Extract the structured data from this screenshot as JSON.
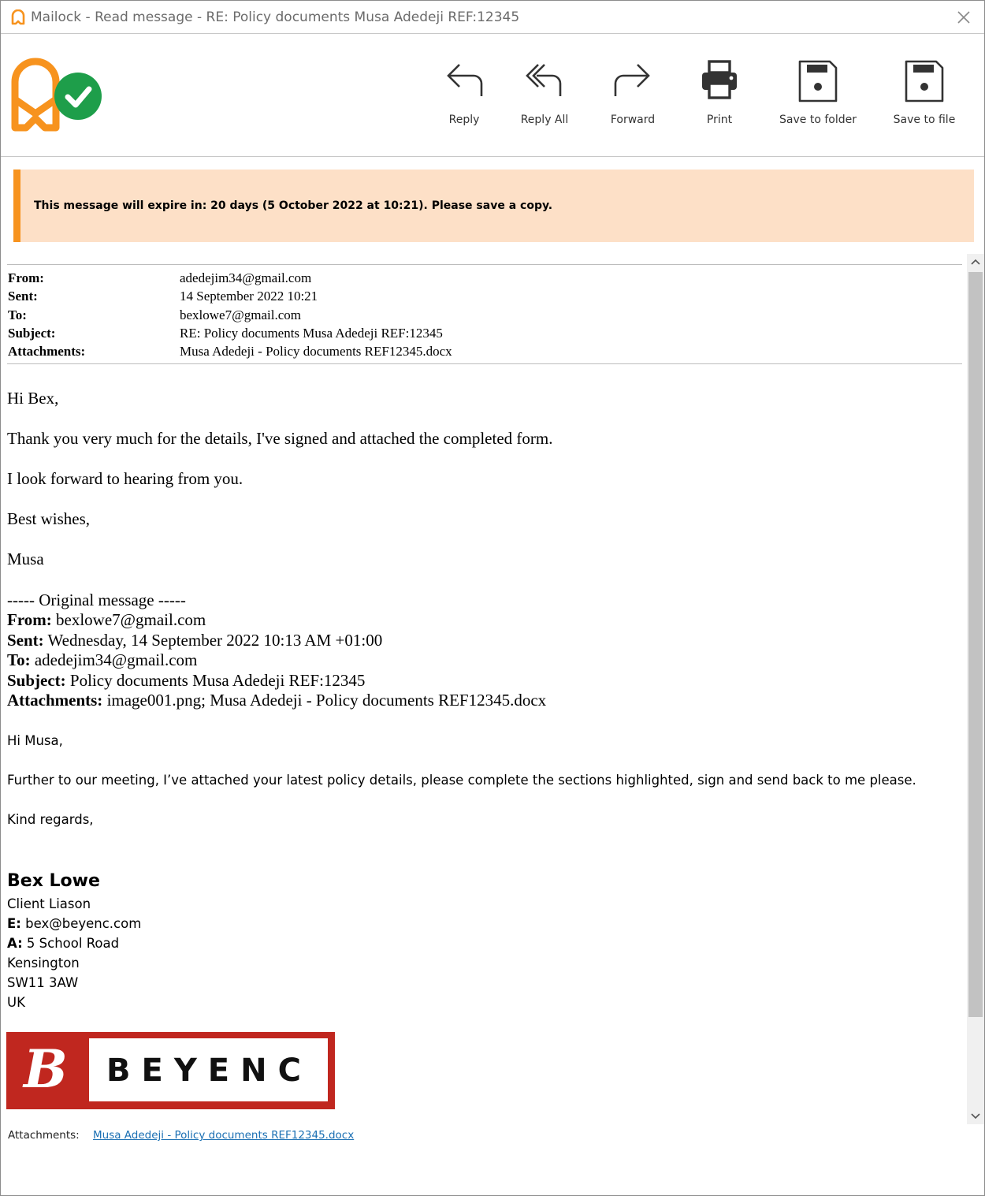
{
  "window": {
    "title": "Mailock - Read message - RE: Policy documents Musa Adedeji REF:12345"
  },
  "toolbar": {
    "reply_label": "Reply",
    "reply_all_label": "Reply All",
    "forward_label": "Forward",
    "print_label": "Print",
    "save_folder_label": "Save to folder",
    "save_file_label": "Save to file"
  },
  "banner": {
    "text": "This message will expire in: 20 days (5 October 2022 at 10:21). Please save a copy."
  },
  "header": {
    "from_label": "From:",
    "from_value": "adedejim34@gmail.com",
    "sent_label": "Sent:",
    "sent_value": "14 September 2022 10:21",
    "to_label": "To:",
    "to_value": "bexlowe7@gmail.com",
    "subject_label": "Subject:",
    "subject_value": "RE: Policy documents Musa Adedeji REF:12345",
    "attachments_label": "Attachments:",
    "attachments_value": "Musa Adedeji - Policy documents REF12345.docx"
  },
  "body": {
    "greeting": "Hi Bex,",
    "line1": "Thank you very much for the details, I've signed and attached the completed form.",
    "line2": "I look forward to hearing from you.",
    "closing": "Best wishes,",
    "signoff": "Musa"
  },
  "original": {
    "divider": "----- Original message -----",
    "from_label": "From:",
    "from_value": " bexlowe7@gmail.com",
    "sent_label": "Sent:",
    "sent_value": " Wednesday, 14 September 2022 10:13 AM +01:00",
    "to_label": "To:",
    "to_value": " adedejim34@gmail.com",
    "subject_label": "Subject:",
    "subject_value": " Policy documents Musa Adedeji REF:12345",
    "attachments_label": "Attachments:",
    "attachments_value": " image001.png; Musa Adedeji - Policy documents REF12345.docx",
    "greeting": "Hi Musa,",
    "line1": "Further to our meeting, I’ve attached your latest policy details, please complete the sections highlighted, sign and send back to me please.",
    "closing": "Kind regards,"
  },
  "signature": {
    "name": "Bex Lowe",
    "role": "Client Liason",
    "email_label": "E:",
    "email_value": " bex@beyenc.com",
    "address_label": "A:",
    "address_value": " 5 School Road",
    "address_line2": "Kensington",
    "address_line3": "SW11 3AW",
    "address_line4": "UK",
    "logo_text": "BEYENC",
    "logo_mark": "B"
  },
  "footer": {
    "attachments_label": "Attachments:",
    "attachment_link": "Musa Adedeji - Policy documents REF12345.docx"
  },
  "colors": {
    "accent_orange": "#f7931e",
    "banner_bg": "#fde0c7",
    "check_green": "#1e9e4a",
    "brand_red": "#c0271f",
    "link_blue": "#1a6fb3"
  }
}
